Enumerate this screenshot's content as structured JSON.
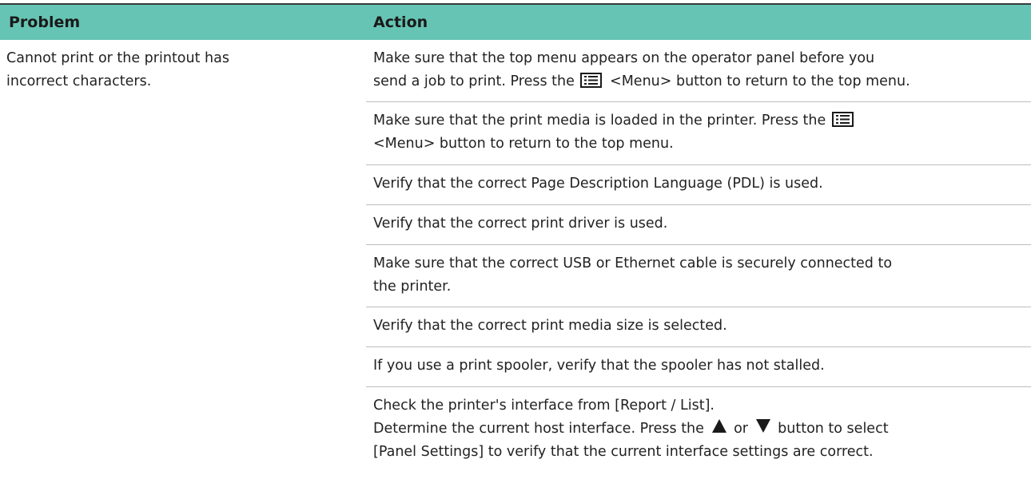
{
  "table": {
    "headers": {
      "problem": "Problem",
      "action": "Action"
    },
    "problem": {
      "line1": "Cannot print or the printout has",
      "line2": "incorrect characters."
    },
    "actions": [
      {
        "l1": "Make sure that the top menu appears on the operator panel before you",
        "l2a": "send a job to print. Press the",
        "l2b": "<Menu> button to return to the top menu."
      },
      {
        "l1a": "Make sure that the print media is loaded in the printer. Press the",
        "l2": "<Menu> button to return to the top menu."
      },
      {
        "l1": "Verify that the correct Page Description Language (PDL) is used."
      },
      {
        "l1": "Verify that the correct print driver is used."
      },
      {
        "l1": "Make sure that the correct USB or Ethernet cable is securely connected to",
        "l2": "the printer."
      },
      {
        "l1": "Verify that the correct print media size is selected."
      },
      {
        "l1": "If you use a print spooler, verify that the spooler has not stalled."
      },
      {
        "l1": "Check the printer's interface from [Report / List].",
        "l2a": "Determine the current host interface. Press the",
        "l2b": "or",
        "l2c": "button to select",
        "l3": "[Panel Settings] to verify that the current interface settings are correct."
      }
    ],
    "icons": {
      "menu": "menu-button-icon",
      "up": "up-arrow-icon",
      "down": "down-arrow-icon"
    }
  }
}
